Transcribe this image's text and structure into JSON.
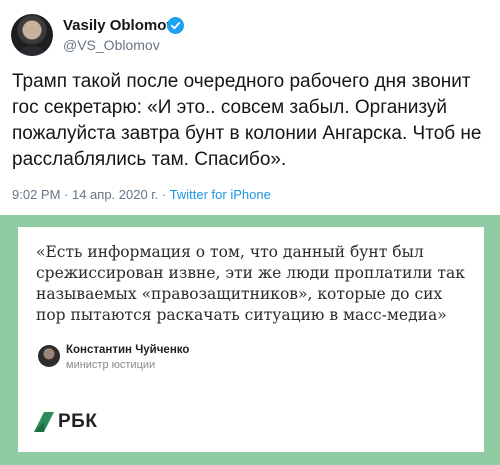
{
  "tweet": {
    "author_name": "Vasily Oblomov",
    "author_handle": "@VS_Oblomov",
    "verified_icon": "verified-badge-icon",
    "text": "Трамп такой после очередного рабочего дня звонит гос секретарю: «И это.. совсем забыл. Организуй пожалуйста завтра бунт в колонии Ангарска. Чтоб не расслаблялись там. Спасибо».",
    "time": "9:02 PM",
    "separator": " · ",
    "date": "14 апр. 2020 г.",
    "source": "Twitter for iPhone"
  },
  "attached_image": {
    "quote": "«Есть информация о том, что данный бунт был срежиссирован извне, эти же люди проплатили так называемых «правозащитников», которые до сих пор пытаются раскачать ситуацию в масс-медиа»",
    "person_name": "Константин Чуйченко",
    "person_role": "министр юстиции",
    "logo_text": "РБК",
    "frame_color": "#8fcca3"
  }
}
